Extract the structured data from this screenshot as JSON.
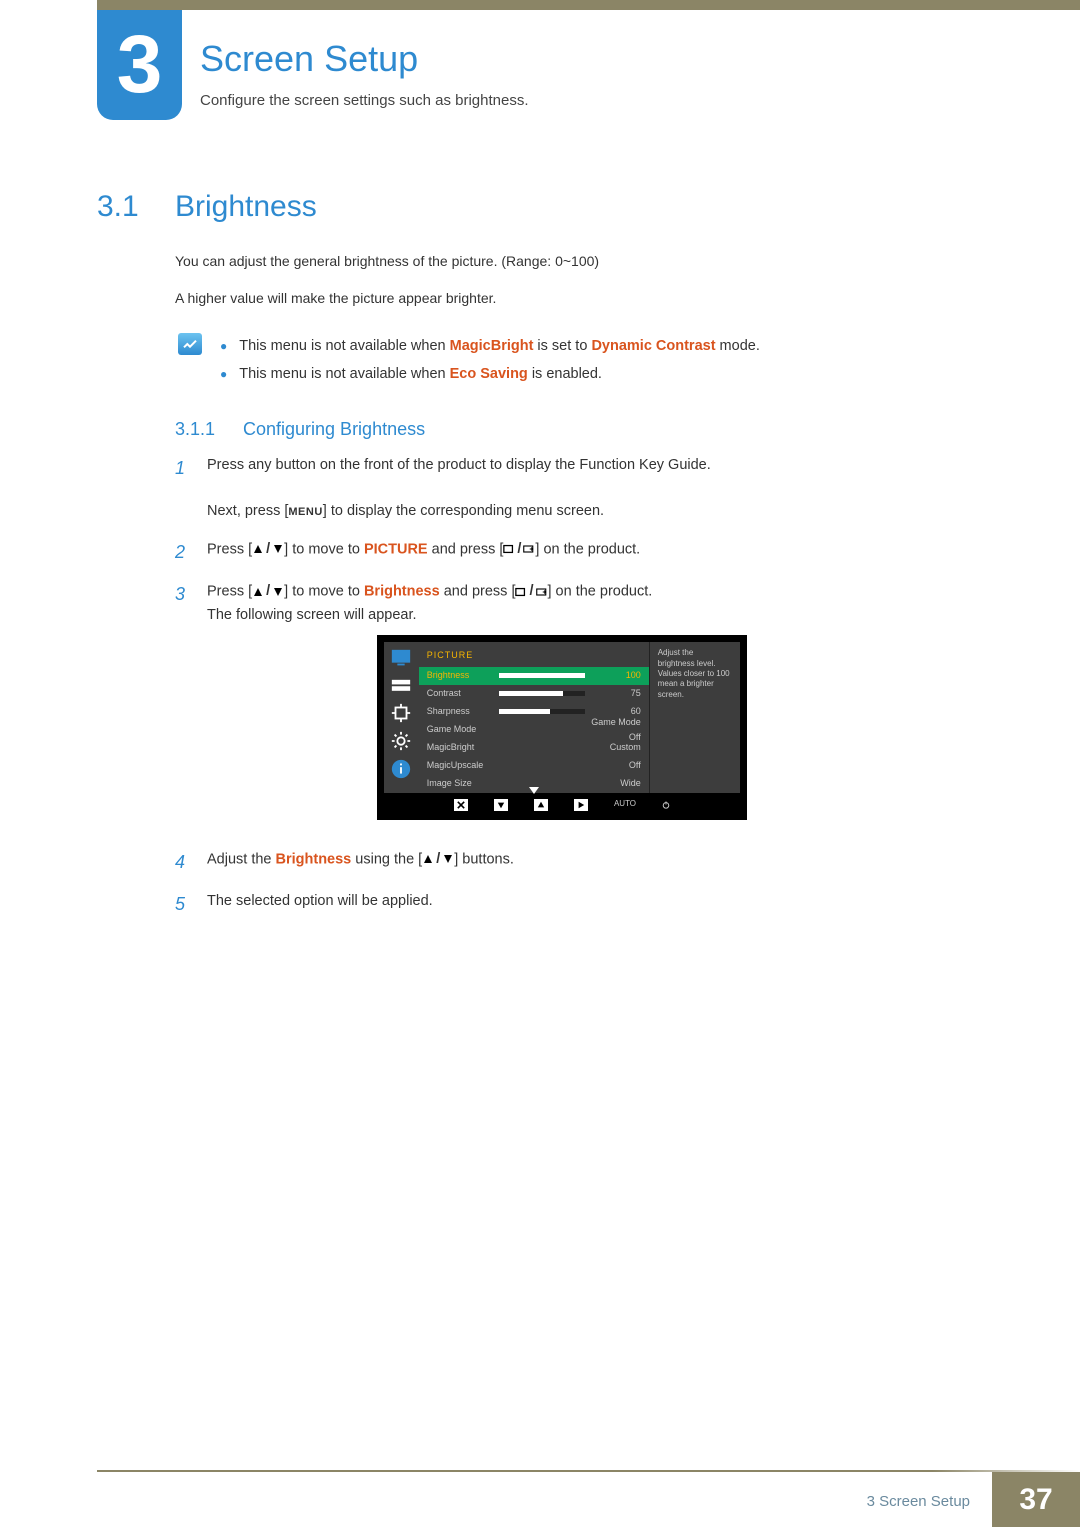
{
  "chapter": {
    "number": "3",
    "title": "Screen Setup",
    "subtitle": "Configure the screen settings such as brightness."
  },
  "section": {
    "number": "3.1",
    "title": "Brightness"
  },
  "para1": "You can adjust the general brightness of the picture. (Range: 0~100)",
  "para2": "A higher value will make the picture appear brighter.",
  "notes": {
    "n1a": "This menu is not available when ",
    "n1_kw1": "MagicBright",
    "n1b": " is set to ",
    "n1_kw2": "Dynamic Contrast",
    "n1c": " mode.",
    "n2a": "This menu is not available when ",
    "n2_kw": "Eco Saving",
    "n2b": " is enabled."
  },
  "subsection": {
    "number": "3.1.1",
    "title": "Configuring Brightness"
  },
  "steps": {
    "s1a": "Press any button on the front of the product to display the Function Key Guide.",
    "s1b_a": "Next, press [",
    "s1b_menu": "MENU",
    "s1b_b": "] to display the corresponding menu screen.",
    "s2a": "Press [",
    "s2b": "] to move to ",
    "s2_kw": "PICTURE",
    "s2c": " and press [",
    "s2d": "] on the product.",
    "s3a": "Press [",
    "s3b": "] to move to ",
    "s3_kw": "Brightness",
    "s3c": " and press [",
    "s3d": "] on the product.",
    "s3e": "The following screen will appear.",
    "s4a": "Adjust the ",
    "s4_kw": "Brightness",
    "s4b": " using the [",
    "s4c": "] buttons.",
    "s5": "The selected option will be applied."
  },
  "osd": {
    "header": "PICTURE",
    "help": "Adjust the brightness level. Values closer to 100 mean a brighter screen.",
    "rows": [
      {
        "label": "Brightness",
        "value": "100",
        "bar": 100,
        "selected": true
      },
      {
        "label": "Contrast",
        "value": "75",
        "bar": 75,
        "selected": false
      },
      {
        "label": "Sharpness",
        "value": "60",
        "bar": 60,
        "selected": false
      },
      {
        "label": "Game Mode",
        "value": "Game Mode Off",
        "bar": null,
        "selected": false
      },
      {
        "label": "MagicBright",
        "value": "Custom",
        "bar": null,
        "selected": false
      },
      {
        "label": "MagicUpscale",
        "value": "Off",
        "bar": null,
        "selected": false
      },
      {
        "label": "Image Size",
        "value": "Wide",
        "bar": null,
        "selected": false
      }
    ],
    "bottom_auto": "AUTO"
  },
  "footer": {
    "label": "3 Screen Setup",
    "page": "37"
  }
}
